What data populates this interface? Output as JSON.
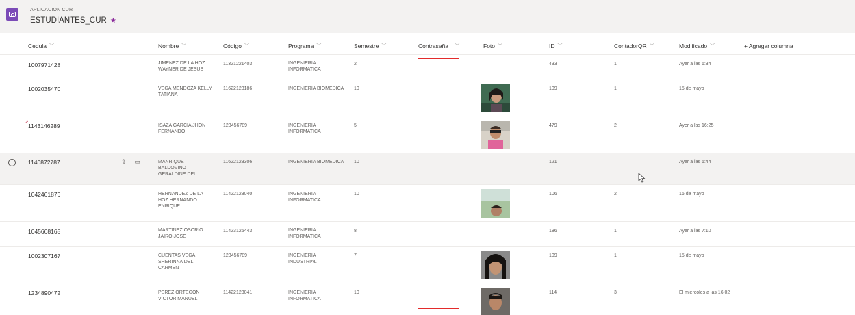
{
  "header": {
    "app_label": "APLICACION CUR",
    "list_title": "ESTUDIANTES_CUR",
    "star": "★"
  },
  "columns": [
    {
      "label": "Cedula",
      "indicator": "﹀"
    },
    {
      "label": "Nombre",
      "indicator": "﹀"
    },
    {
      "label": "Código",
      "indicator": "﹀"
    },
    {
      "label": "Programa",
      "indicator": "﹀"
    },
    {
      "label": "Semestre",
      "indicator": "﹀"
    },
    {
      "label": "Contraseña",
      "indicator": "↓ ﹀"
    },
    {
      "label": "Foto",
      "indicator": "﹀"
    },
    {
      "label": "ID",
      "indicator": "﹀"
    },
    {
      "label": "ContadorQR",
      "indicator": "﹀"
    },
    {
      "label": "Modificado",
      "indicator": "﹀"
    }
  ],
  "add_column": "+ Agregar columna",
  "row_actions": {
    "more": "···",
    "share": "⇪",
    "comment": "▭"
  },
  "edit_mark": "↗",
  "rows": [
    {
      "cedula": "1007971428",
      "nombre": "JIMENEZ DE LA HOZ WAYNER DE JESUS",
      "codigo": "11321221403",
      "programa": "INGENIERIA INFORMATICA",
      "semestre": "2",
      "id": "433",
      "contador": "1",
      "modificado": "Ayer a las 6:34"
    },
    {
      "cedula": "1002035470",
      "nombre": "VEGA MENDOZA KELLY TATIANA",
      "codigo": "11622123186",
      "programa": "INGENIERIA BIOMEDICA",
      "semestre": "10",
      "id": "109",
      "contador": "1",
      "modificado": "15 de mayo"
    },
    {
      "cedula": "1143146289",
      "nombre": "ISAZA GARCIA JHON FERNANDO",
      "codigo": "123456789",
      "programa": "INGENIERIA INFORMATICA",
      "semestre": "5",
      "id": "479",
      "contador": "2",
      "modificado": "Ayer a las 16:25"
    },
    {
      "cedula": "1140872787",
      "nombre": "MANRIQUE BALDOVINO GERALDINE DEL",
      "codigo": "11622123306",
      "programa": "INGENIERIA BIOMEDICA",
      "semestre": "10",
      "id": "121",
      "contador": "",
      "modificado": "Ayer a las 5:44"
    },
    {
      "cedula": "1042461876",
      "nombre": "HERNANDEZ DE LA HOZ HERNANDO ENRIQUE",
      "codigo": "11422123040",
      "programa": "INGENIERIA INFORMATICA",
      "semestre": "10",
      "id": "106",
      "contador": "2",
      "modificado": "16 de mayo"
    },
    {
      "cedula": "1045668165",
      "nombre": "MARTINEZ OSORIO JAIRO JOSE",
      "codigo": "11423125443",
      "programa": "INGENIERIA INFORMATICA",
      "semestre": "8",
      "id": "186",
      "contador": "1",
      "modificado": "Ayer a las 7:10"
    },
    {
      "cedula": "1002307167",
      "nombre": "CUENTAS VEGA SHERINNA DEL CARMEN",
      "codigo": "123456789",
      "programa": "INGENIERIA INDUSTRIAL",
      "semestre": "7",
      "id": "109",
      "contador": "1",
      "modificado": "15 de mayo"
    },
    {
      "cedula": "1234890472",
      "nombre": "PEREZ ORTEGON VICTOR MANUEL",
      "codigo": "11422123041",
      "programa": "INGENIERIA INFORMATICA",
      "semestre": "10",
      "id": "114",
      "contador": "3",
      "modificado": "El miércoles a las 16:02"
    }
  ]
}
